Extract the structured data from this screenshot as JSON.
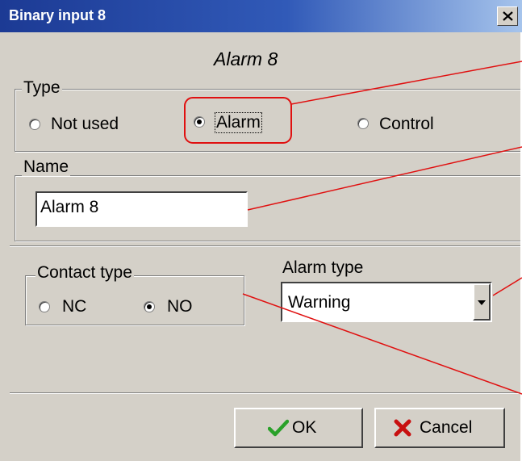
{
  "window": {
    "title": "Binary input 8",
    "close_icon": "close-icon"
  },
  "header": {
    "caption": "Alarm 8"
  },
  "type_group": {
    "legend": "Type",
    "options": [
      {
        "label": "Not used",
        "selected": false
      },
      {
        "label": "Alarm",
        "selected": true
      },
      {
        "label": "Control",
        "selected": false
      }
    ]
  },
  "name_group": {
    "legend": "Name",
    "value": "Alarm 8"
  },
  "contact_group": {
    "legend": "Contact type",
    "options": [
      {
        "label": "NC",
        "selected": false
      },
      {
        "label": "NO",
        "selected": true
      }
    ]
  },
  "alarm_type": {
    "label": "Alarm type",
    "value": "Warning"
  },
  "buttons": {
    "ok_label": "OK",
    "cancel_label": "Cancel"
  },
  "colors": {
    "highlight": "#e01010",
    "titlebar": "#1c3a94",
    "face": "#d4d0c8",
    "ok_check": "#2aa12a",
    "cancel_x": "#c81010"
  }
}
